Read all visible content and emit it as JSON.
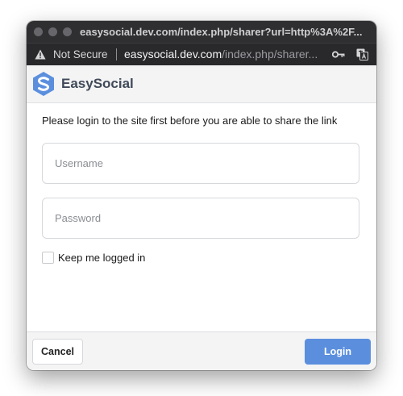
{
  "window": {
    "title": "easysocial.dev.com/index.php/sharer?url=http%3A%2F..."
  },
  "addressbar": {
    "security_label": "Not Secure",
    "url_host": "easysocial.dev.com",
    "url_path": "/index.php/sharer..."
  },
  "brand": {
    "name": "EasySocial",
    "logo_color": "#5b8fde"
  },
  "login": {
    "message": "Please login to the site first before you are able to share the link",
    "username": {
      "placeholder": "Username",
      "value": ""
    },
    "password": {
      "placeholder": "Password",
      "value": ""
    },
    "remember_label": "Keep me logged in",
    "remember_checked": false
  },
  "footer": {
    "cancel_label": "Cancel",
    "login_label": "Login",
    "login_color": "#5b8fde"
  }
}
